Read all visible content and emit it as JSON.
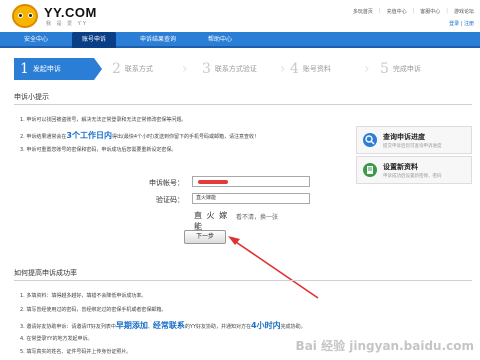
{
  "header": {
    "brand": "YY.COM",
    "brand_sub": "我 是 爱 YY",
    "links": [
      "多玩首页",
      "充值中心",
      "客服中心",
      "游戏论坛"
    ],
    "user_links": "登录 | 注册"
  },
  "nav": {
    "items": [
      "安全中心",
      "账号申诉",
      "申诉结果查询",
      "帮助中心"
    ],
    "active": 1
  },
  "steps": [
    {
      "num": "1",
      "label": "发起申诉"
    },
    {
      "num": "2",
      "label": "联系方式"
    },
    {
      "num": "3",
      "label": "联系方式验证"
    },
    {
      "num": "4",
      "label": "账号资料"
    },
    {
      "num": "5",
      "label": "完成申诉"
    }
  ],
  "tips": {
    "title": "申诉小提示",
    "item1": "1. 申诉可以找回被盗账号，解决无法正常登录和无法正常修改密保等问题。",
    "item2_pre": "2. 申诉结果通常会在",
    "item2_hl": "3个工作日内",
    "item2_post": "得出(最快4个小时)发送到你留下的手机号码或邮箱，请注意查收！",
    "item3": "3. 申诉可重置您账号的密保和密码，申诉成功后您需要重新设定密保。"
  },
  "side": {
    "query_title": "查询申诉进度",
    "query_desc": "提交申诉后您可查询申诉进度",
    "reset_title": "设置新资料",
    "reset_desc": "申诉成功后设置新密保，密码"
  },
  "form": {
    "account_label": "申诉帐号：",
    "captcha_label": "验证码：",
    "captcha_value": "直火嫁能",
    "captcha_image": "直 火 嫁 能",
    "captcha_refresh": "看不清，换一张",
    "next_label": "下一步"
  },
  "bottom": {
    "title": "如何提高申诉成功率",
    "b1": "1. 多填资料：填得越多越好，填错不会降低申诉成功率。",
    "b2": "2. 填写曾经使用过的密码，曾经绑定过的密保手机或者密保邮箱。",
    "b3_pre": "3. 邀请好友协助申诉：请邀请IT好友列表中",
    "b3_hl1": "早期添加",
    "b3_mid": "、",
    "b3_hl2": "经常联系",
    "b3_post1": "的YY好友协助，并通知对方在",
    "b3_hl3": "4小时内",
    "b3_post2": "完成协助。",
    "b4": "4. 在常登录YY的地方发起申诉。",
    "b5": "5. 填写真实的姓名、证件号码并上传身份证照片。"
  },
  "watermark": "Bai 经验 jingyan.baidu.com",
  "colors": {
    "nav_blue": "#2a7ed6",
    "nav_active": "#0a3f86",
    "link_blue": "#1a6fc9",
    "annotation_red": "#e03030"
  }
}
